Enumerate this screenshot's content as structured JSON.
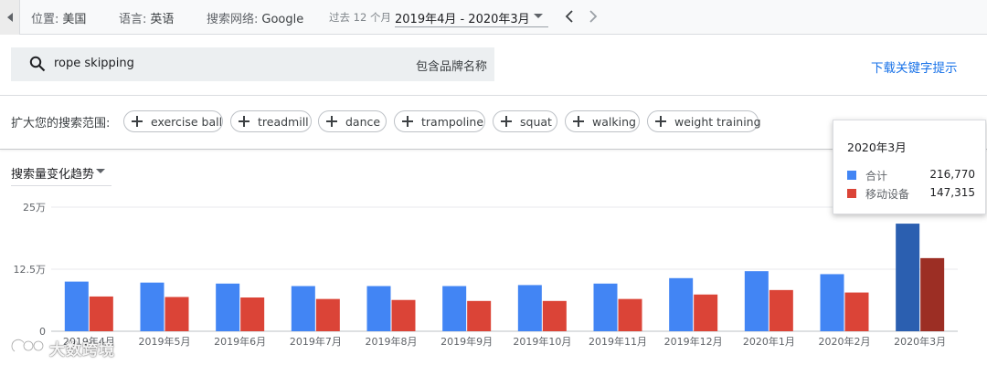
{
  "topbar": {
    "location_label": "位置:",
    "location_value": "美国",
    "language_label": "语言:",
    "language_value": "英语",
    "network_label": "搜索网络:",
    "network_value": "Google",
    "period_label": "过去 12 个月",
    "date_range": "2019年4月 - 2020年3月"
  },
  "search": {
    "query": "rope skipping",
    "brand_toggle": "包含品牌名称",
    "download_link": "下载关键字提示"
  },
  "expand": {
    "label": "扩大您的搜索范围:",
    "chips": [
      "exercise ball",
      "treadmill",
      "dance",
      "trampoline",
      "squat",
      "walking",
      "weight training"
    ]
  },
  "trend_dropdown": "搜索量变化趋势",
  "tooltip": {
    "title": "2020年3月",
    "rows": [
      {
        "label": "合计",
        "value": "216,770"
      },
      {
        "label": "移动设备",
        "value": "147,315"
      }
    ]
  },
  "watermark": "大数跨境",
  "colors": {
    "total": "#4285f4",
    "mobile": "#db4437",
    "total_highlight": "#2b5fb0",
    "mobile_highlight": "#9c2e24",
    "accent_link": "#1a73e8"
  },
  "chart_data": {
    "type": "bar",
    "categories": [
      "2019年4月",
      "2019年5月",
      "2019年6月",
      "2019年7月",
      "2019年8月",
      "2019年9月",
      "2019年10月",
      "2019年11月",
      "2019年12月",
      "2020年1月",
      "2020年2月",
      "2020年3月"
    ],
    "series": [
      {
        "name": "合计",
        "values": [
          100000,
          98000,
          96000,
          91000,
          91000,
          91000,
          93000,
          96000,
          107000,
          121000,
          115000,
          216770
        ]
      },
      {
        "name": "移动设备",
        "values": [
          70000,
          69000,
          68000,
          65000,
          63000,
          61000,
          61000,
          65000,
          74000,
          83000,
          78000,
          147315
        ]
      }
    ],
    "yticks": [
      {
        "value": 0,
        "label": "0"
      },
      {
        "value": 125000,
        "label": "12.5万"
      },
      {
        "value": 250000,
        "label": "25万"
      }
    ],
    "ylim": [
      0,
      250000
    ],
    "highlight_index": 11,
    "grid": true,
    "legend": "tooltip"
  }
}
